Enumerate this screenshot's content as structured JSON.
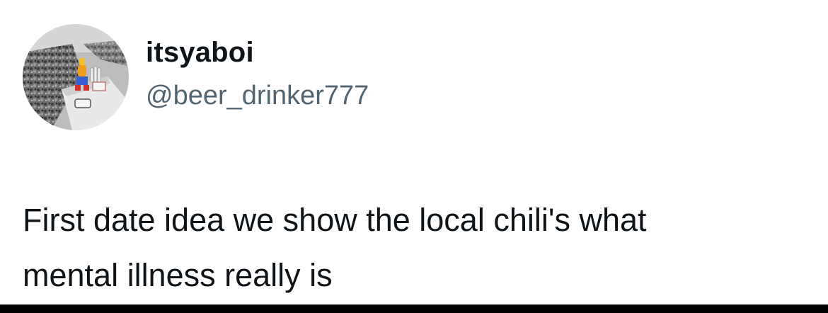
{
  "author": {
    "display_name": "itsyaboi",
    "handle": "@beer_drinker777",
    "avatar_icon": "profile-photo"
  },
  "tweet": {
    "lines": [
      "First date idea we show the local chili's what",
      "mental illness really is"
    ]
  },
  "colors": {
    "background": "#ffffff",
    "text_primary": "#0f1419",
    "text_secondary": "#536471",
    "bottom_bar": "#000000"
  }
}
